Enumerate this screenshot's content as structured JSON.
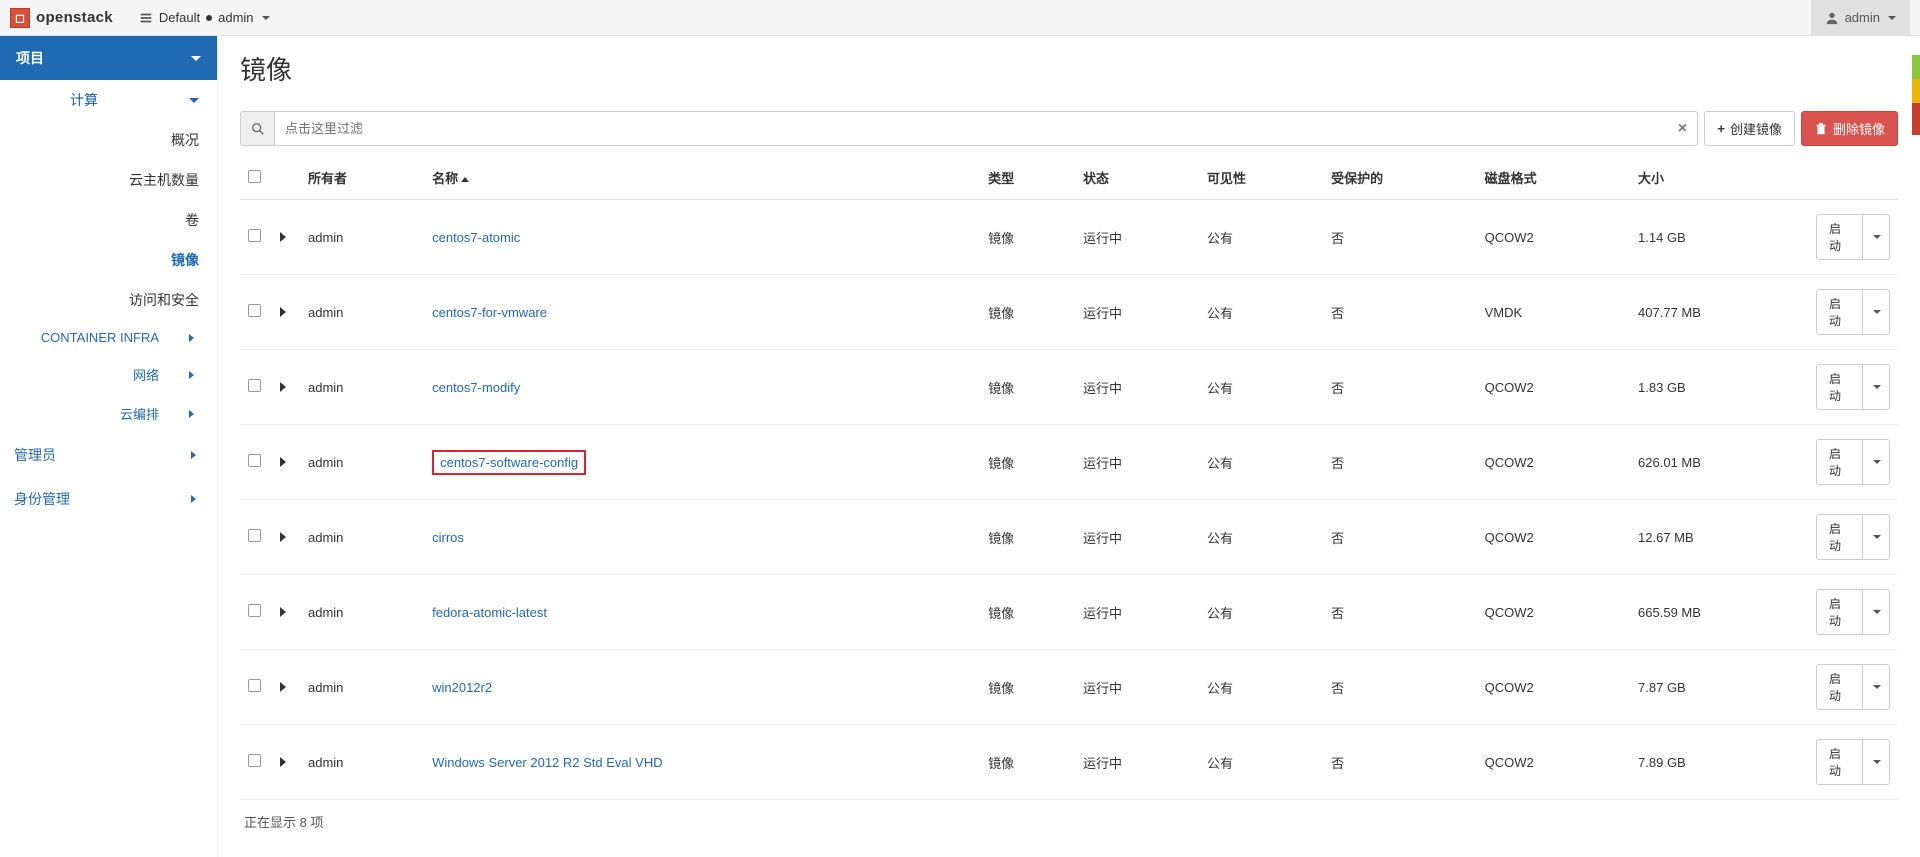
{
  "brand": "openstack",
  "context": {
    "domain_label": "Default",
    "project_label": "admin"
  },
  "user_menu": {
    "label": "admin"
  },
  "sidebar": {
    "project": "项目",
    "compute": "计算",
    "overview": "概况",
    "instances": "云主机数量",
    "volumes": "卷",
    "images": "镜像",
    "access": "访问和安全",
    "container_infra": "CONTAINER INFRA",
    "network": "网络",
    "orchestration": "云编排",
    "admin": "管理员",
    "identity": "身份管理"
  },
  "page": {
    "title": "镜像"
  },
  "search": {
    "placeholder": "点击这里过滤"
  },
  "buttons": {
    "create": "创建镜像",
    "delete": "删除镜像",
    "launch": "启动"
  },
  "columns": {
    "owner": "所有者",
    "name": "名称",
    "type": "类型",
    "status": "状态",
    "visibility": "可见性",
    "protected": "受保护的",
    "disk_format": "磁盘格式",
    "size": "大小"
  },
  "rows": [
    {
      "owner": "admin",
      "name": "centos7-atomic",
      "type": "镜像",
      "status": "运行中",
      "visibility": "公有",
      "protected": "否",
      "disk_format": "QCOW2",
      "size": "1.14 GB",
      "highlighted": false
    },
    {
      "owner": "admin",
      "name": "centos7-for-vmware",
      "type": "镜像",
      "status": "运行中",
      "visibility": "公有",
      "protected": "否",
      "disk_format": "VMDK",
      "size": "407.77 MB",
      "highlighted": false
    },
    {
      "owner": "admin",
      "name": "centos7-modify",
      "type": "镜像",
      "status": "运行中",
      "visibility": "公有",
      "protected": "否",
      "disk_format": "QCOW2",
      "size": "1.83 GB",
      "highlighted": false
    },
    {
      "owner": "admin",
      "name": "centos7-software-config",
      "type": "镜像",
      "status": "运行中",
      "visibility": "公有",
      "protected": "否",
      "disk_format": "QCOW2",
      "size": "626.01 MB",
      "highlighted": true
    },
    {
      "owner": "admin",
      "name": "cirros",
      "type": "镜像",
      "status": "运行中",
      "visibility": "公有",
      "protected": "否",
      "disk_format": "QCOW2",
      "size": "12.67 MB",
      "highlighted": false
    },
    {
      "owner": "admin",
      "name": "fedora-atomic-latest",
      "type": "镜像",
      "status": "运行中",
      "visibility": "公有",
      "protected": "否",
      "disk_format": "QCOW2",
      "size": "665.59 MB",
      "highlighted": false
    },
    {
      "owner": "admin",
      "name": "win2012r2",
      "type": "镜像",
      "status": "运行中",
      "visibility": "公有",
      "protected": "否",
      "disk_format": "QCOW2",
      "size": "7.87 GB",
      "highlighted": false
    },
    {
      "owner": "admin",
      "name": "Windows Server 2012 R2 Std Eval VHD",
      "type": "镜像",
      "status": "运行中",
      "visibility": "公有",
      "protected": "否",
      "disk_format": "QCOW2",
      "size": "7.89 GB",
      "highlighted": false
    }
  ],
  "footer": {
    "count_text": "正在显示 8 项"
  }
}
